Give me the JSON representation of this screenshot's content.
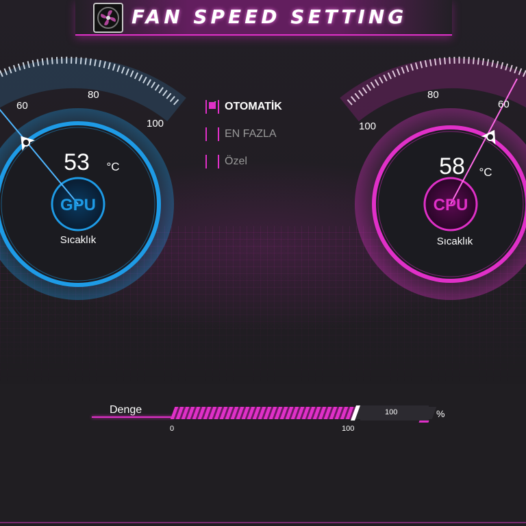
{
  "header": {
    "title": "FAN SPEED SETTING",
    "icon": "fan-icon"
  },
  "gpu_gauge": {
    "label": "GPU",
    "temperature": "53",
    "unit": "°C",
    "caption": "Sıcaklık",
    "ticks": [
      "60",
      "80",
      "100"
    ],
    "color": "#1e9be6"
  },
  "cpu_gauge": {
    "label": "CPU",
    "temperature": "58",
    "unit": "°C",
    "caption": "Sıcaklık",
    "ticks": [
      "100",
      "80",
      "60"
    ],
    "color": "#e030c8"
  },
  "modes": [
    {
      "label": "OTOMATİK",
      "checked": true
    },
    {
      "label": "EN FAZLA",
      "checked": false
    },
    {
      "label": "Özel",
      "checked": false
    }
  ],
  "balance": {
    "label": "Denge",
    "min": "0",
    "max": "100",
    "value": "100",
    "unit": "%",
    "fill_fraction": 1.0
  },
  "colors": {
    "accent": "#e030c8",
    "gpu": "#1e9be6",
    "background": "#201e22"
  }
}
